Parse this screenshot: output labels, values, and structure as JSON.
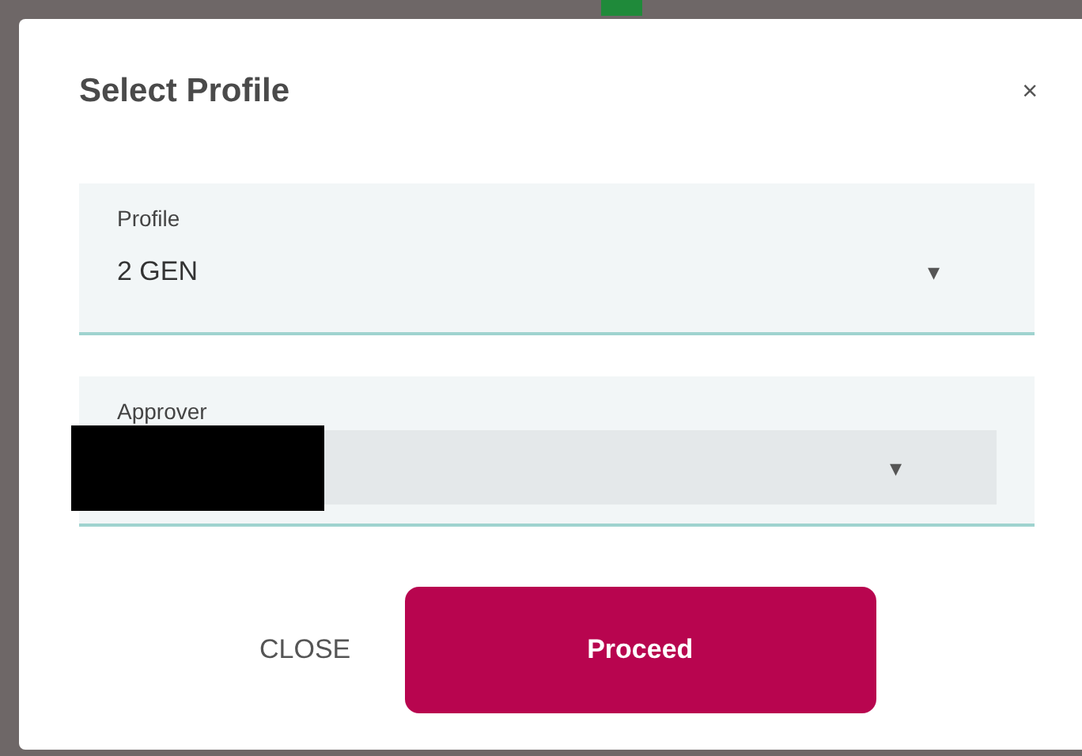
{
  "dialog": {
    "title": "Select Profile",
    "close_icon": "×"
  },
  "fields": [
    {
      "label": "Profile",
      "value": "2 GEN",
      "arrow": "▾",
      "redacted": false
    },
    {
      "label": "Approver",
      "arrow": "▾",
      "redacted": true
    }
  ],
  "buttons": [
    {
      "label": "CLOSE",
      "kind": "text"
    },
    {
      "label": "Proceed",
      "kind": "primary"
    }
  ]
}
